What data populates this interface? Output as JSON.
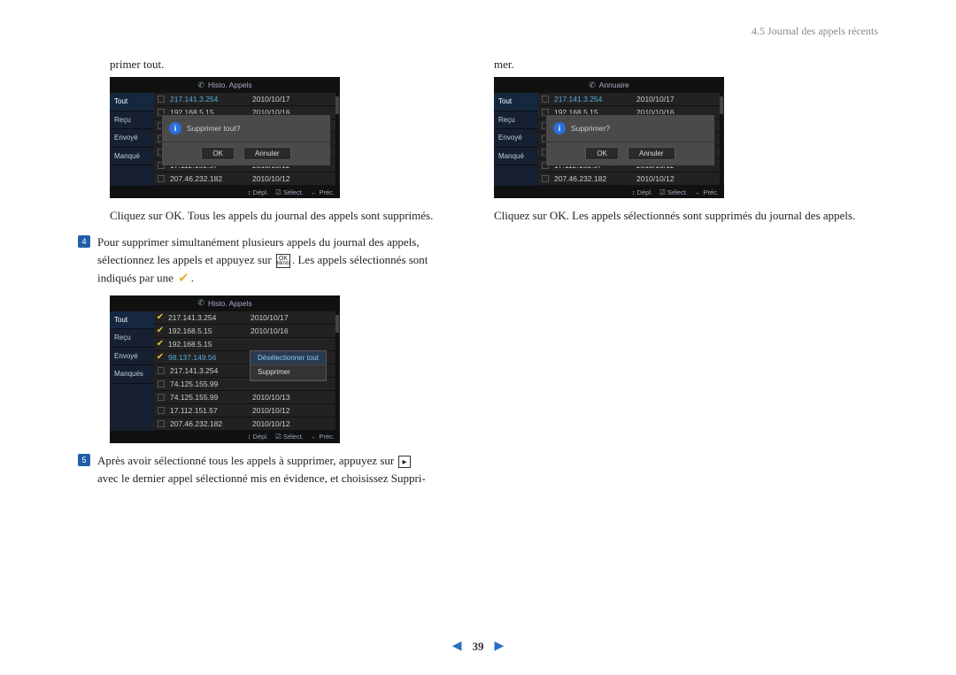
{
  "header": {
    "section": "4.5 Journal des appels récents"
  },
  "left": {
    "intro_cont": "primer tout.",
    "dev1": {
      "title": "Histo. Appels",
      "tabs": [
        "Tout",
        "Reçu",
        "Envoyé",
        "Manqué"
      ],
      "rows": [
        {
          "ip": "217.141.3.254",
          "dt": "2010/10/17",
          "hi": true
        },
        {
          "ip": "192.168.5.15",
          "dt": "2010/10/16"
        },
        {
          "ip": "",
          "dt": ""
        },
        {
          "ip": "",
          "dt": ""
        },
        {
          "ip": "",
          "dt": ""
        },
        {
          "ip": "17.112.151.57",
          "dt": "2010/10/12"
        },
        {
          "ip": "207.46.232.182",
          "dt": "2010/10/12"
        }
      ],
      "modal": {
        "msg": "Supprimer tout?",
        "ok": "OK",
        "cancel": "Annuler"
      },
      "foot": {
        "a": "↕ Dépl.",
        "b": "☑ Sélect.",
        "c": "← Préc."
      }
    },
    "caption1": "Cliquez sur OK. Tous les appels du journal des appels sont supprimés.",
    "step4a": "Pour supprimer simultanément plusieurs appels du journal des appels, sélectionnez les appels et appuyez sur ",
    "step4b": ". Les appels sélectionnés sont indiqués par une ",
    "step4c": ".",
    "dev2": {
      "title": "Histo. Appels",
      "tabs": [
        "Tout",
        "Reçu",
        "Envoyé",
        "Manqués"
      ],
      "rows": [
        {
          "ip": "217.141.3.254",
          "dt": "2010/10/17",
          "ck": true
        },
        {
          "ip": "192.168.5.15",
          "dt": "2010/10/16",
          "ck": true
        },
        {
          "ip": "192.168.5.15",
          "dt": "",
          "ck": true
        },
        {
          "ip": "98.137.149.56",
          "dt": "",
          "ck": true,
          "hi": true
        },
        {
          "ip": "217.141.3.254",
          "dt": ""
        },
        {
          "ip": "74.125.155.99",
          "dt": ""
        },
        {
          "ip": "74.125.155.99",
          "dt": "2010/10/13"
        },
        {
          "ip": "17.112.151.57",
          "dt": "2010/10/12"
        },
        {
          "ip": "207.46.232.182",
          "dt": "2010/10/12"
        }
      ],
      "ctx": {
        "opt1": "Désélectionner tout",
        "opt2": "Supprimer"
      },
      "foot": {
        "a": "↕ Dépl.",
        "b": "☑ Sélect.",
        "c": "← Préc."
      }
    },
    "step5a": "Après avoir sélectionné tous les appels à supprimer, appuyez sur ",
    "step5b": " avec le dernier appel sélectionné mis en évidence, et choisissez Suppri-"
  },
  "right": {
    "intro_cont": "mer.",
    "dev1": {
      "title": "Annuaire",
      "tabs": [
        "Tout",
        "Reçu",
        "Envoyé",
        "Manqué"
      ],
      "rows": [
        {
          "ip": "217.141.3.254",
          "dt": "2010/10/17",
          "hi": true
        },
        {
          "ip": "192.168.5.15",
          "dt": "2010/10/16"
        },
        {
          "ip": "",
          "dt": ""
        },
        {
          "ip": "",
          "dt": ""
        },
        {
          "ip": "",
          "dt": ""
        },
        {
          "ip": "17.112.151.57",
          "dt": "2010/10/12"
        },
        {
          "ip": "207.46.232.182",
          "dt": "2010/10/12"
        }
      ],
      "modal": {
        "msg": "Supprimer?",
        "ok": "OK",
        "cancel": "Annuler"
      },
      "foot": {
        "a": "↕ Dépl.",
        "b": "☑ Sélect.",
        "c": "← Préc."
      }
    },
    "caption1": "Cliquez sur OK. Les appels sélectionnés sont supprimés du journal des appels."
  },
  "okbtn": {
    "top": "OK",
    "bottom": "MENU"
  },
  "page": {
    "num": "39"
  }
}
